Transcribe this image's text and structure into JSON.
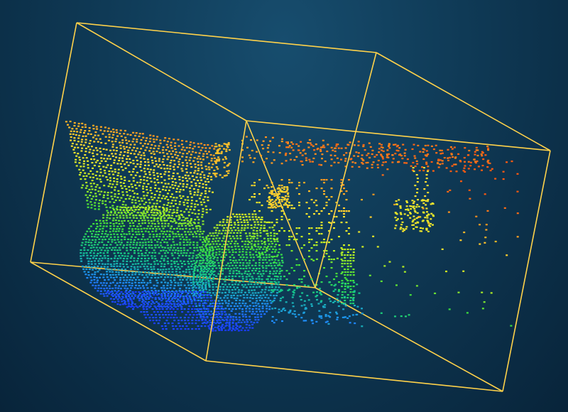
{
  "viewer": {
    "background_colors": [
      "#174d6e",
      "#0f3a56",
      "#08243a"
    ],
    "bounding_box_color": "#ffd24a",
    "colormap": [
      "#1a2cff",
      "#1f8bff",
      "#14c98a",
      "#3ee03a",
      "#c8f020",
      "#ffe030",
      "#ff9a20",
      "#ff5a10"
    ],
    "colormap_axis": "height"
  }
}
